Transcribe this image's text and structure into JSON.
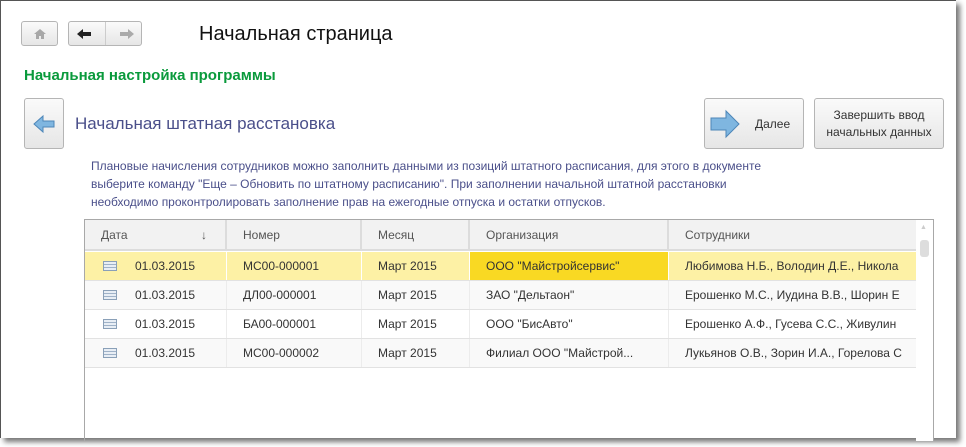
{
  "page_title": "Начальная страница",
  "section_title": "Начальная настройка программы",
  "step_title": "Начальная штатная расстановка",
  "buttons": {
    "next": "Далее",
    "finish_line1": "Завершить ввод",
    "finish_line2": "начальных данных"
  },
  "description": [
    "Плановые начисления сотрудников можно заполнить данными из позиций штатного расписания, для этого в документе",
    "выберите команду \"Еще – Обновить по штатному расписанию\". При заполнении начальной штатной расстановки",
    "необходимо проконтролировать заполнение прав на ежегодные отпуска и остатки отпусков."
  ],
  "table": {
    "columns": [
      "Дата",
      "Номер",
      "Месяц",
      "Организация",
      "Сотрудники"
    ],
    "sort_indicator": "↓",
    "rows": [
      [
        "01.03.2015",
        "МС00-000001",
        "Март 2015",
        "ООО \"Майстройсервис\"",
        "Любимова Н.Б., Володин Д.Е., Никола"
      ],
      [
        "01.03.2015",
        "ДЛ00-000001",
        "Март 2015",
        "ЗАО \"Дельтаон\"",
        "Ерошенко М.С., Иудина В.В., Шорин Е"
      ],
      [
        "01.03.2015",
        "БА00-000001",
        "Март 2015",
        "ООО \"БисАвто\"",
        "Ерошенко А.Ф., Гусева С.С., Живулин"
      ],
      [
        "01.03.2015",
        "МС00-000002",
        "Март 2015",
        "Филиал ООО \"Майстрой...",
        "Лукьянов О.В., Зорин И.А., Горелова С"
      ]
    ]
  },
  "colors": {
    "section": "#0a9a3c",
    "step": "#4a4f8a",
    "selected_row": "#fdf1a5",
    "selected_cell": "#f9d923"
  }
}
